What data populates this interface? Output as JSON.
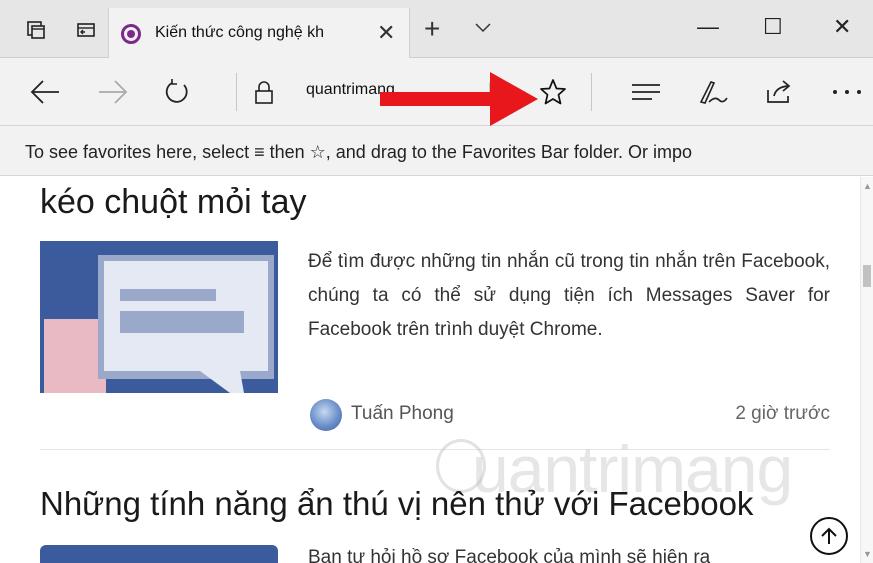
{
  "tab": {
    "title": "Kiến thức công nghệ kh",
    "close_glyph": "✕",
    "new_tab_glyph": "+",
    "tab_list_glyph": "⌄"
  },
  "window": {
    "minimize_glyph": "—",
    "maximize_glyph": "☐",
    "close_glyph": "✕"
  },
  "address": {
    "url": "quantrimang"
  },
  "favorites_hint": "To see favorites here, select ≡ then ☆, and drag to the Favorites Bar folder. Or impo",
  "article_prev": {
    "heading_tail": "kéo chuột mỏi tay",
    "description": "Để tìm được những tin nhắn cũ trong tin nhắn trên Facebook, chúng ta có thể sử dụng tiện ích Messages Saver for Facebook trên trình duyệt Chrome.",
    "author": "Tuấn Phong",
    "time": "2 giờ trước"
  },
  "article_next": {
    "heading": "Những tính năng ẩn thú vị nên thử với Facebook",
    "description_start": "Bạn tự hỏi hồ sơ Facebook của mình sẽ hiện ra"
  },
  "watermark_text": "uantrimang",
  "colors": {
    "arrow": "#e8171b",
    "facebook_blue": "#3b5b9d",
    "tab_favicon": "#7b2a8c"
  },
  "icons": [
    "tab-preview-icon",
    "set-aside-tabs-icon",
    "back-icon",
    "forward-icon",
    "refresh-icon",
    "lock-icon",
    "reading-view-icon",
    "favorite-star-icon",
    "hub-icon",
    "web-note-icon",
    "share-icon",
    "more-icon",
    "scroll-to-top-icon"
  ]
}
